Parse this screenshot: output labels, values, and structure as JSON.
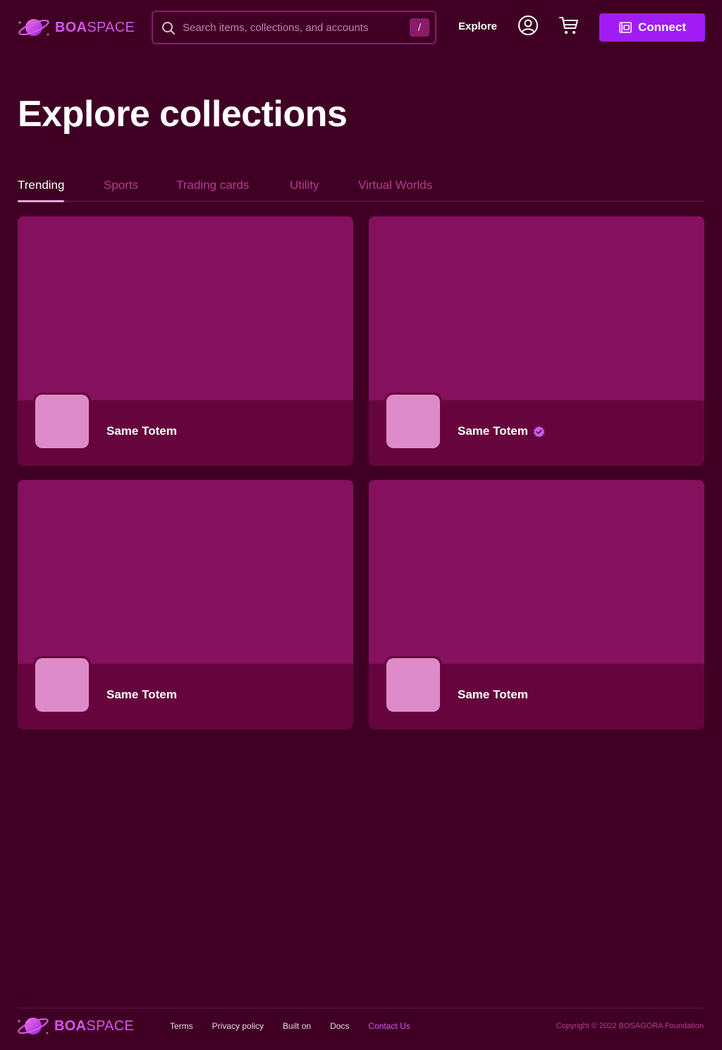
{
  "header": {
    "logo_bold": "BOA",
    "logo_light": "SPACE",
    "search_placeholder": "Search items, collections, and accounts",
    "search_shortcut": "/",
    "nav_explore": "Explore",
    "connect_label": "Connect"
  },
  "page": {
    "title": "Explore collections"
  },
  "tabs": [
    {
      "label": "Trending",
      "active": true
    },
    {
      "label": "Sports",
      "active": false
    },
    {
      "label": "Trading cards",
      "active": false
    },
    {
      "label": "Utility",
      "active": false
    },
    {
      "label": "Virtual Worlds",
      "active": false
    }
  ],
  "collections": [
    {
      "name": "Same Totem",
      "verified": false
    },
    {
      "name": "Same Totem",
      "verified": true
    },
    {
      "name": "Same Totem",
      "verified": false
    },
    {
      "name": "Same Totem",
      "verified": false
    }
  ],
  "footer": {
    "logo_bold": "BOA",
    "logo_light": "SPACE",
    "links": [
      "Terms",
      "Privacy policy",
      "Built on",
      "Docs",
      "Contact Us"
    ],
    "copyright": "Copyright © 2022 BOSAGORA Foundation"
  },
  "colors": {
    "background": "#3f0024",
    "accent": "#a21cf5",
    "brand": "#d855f0",
    "card_banner": "#85105e",
    "card_footer": "#66053d"
  },
  "icons": [
    "planet-logo-icon",
    "search-icon",
    "user-circle-icon",
    "cart-icon",
    "wallet-icon",
    "verified-badge-icon"
  ]
}
